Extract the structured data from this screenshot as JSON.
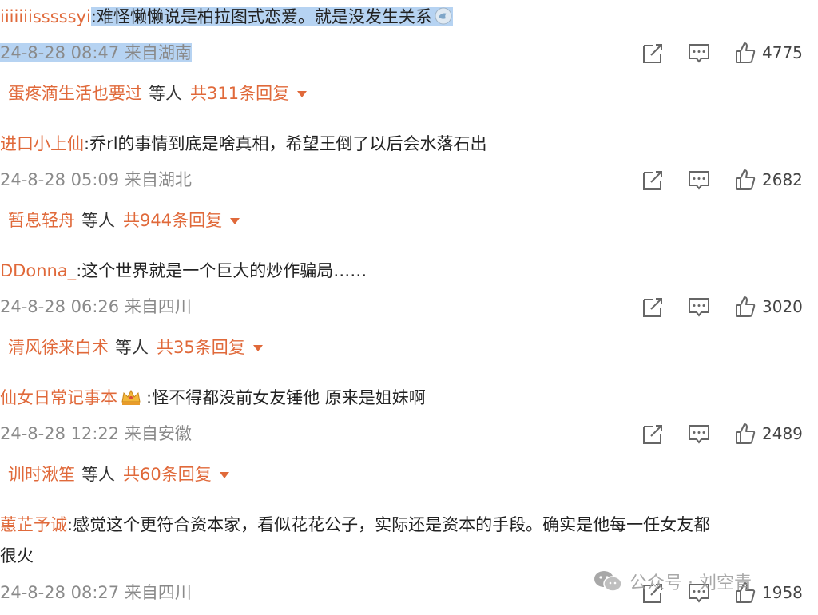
{
  "icons": {
    "share": "share-icon",
    "comment": "comment-icon",
    "like": "thumbs-up-icon",
    "dropdown": "caret-down-icon",
    "wechat": "wechat-logo-icon"
  },
  "colors": {
    "username": "#e0693a",
    "meta": "#8a8a8a",
    "selection": "#b6d3f2"
  },
  "comments": [
    {
      "username": "iiiiiiisssssyi",
      "colon": ":",
      "text": "难怪懒懒说是柏拉图式恋爱。就是没发生关系",
      "meta": "24-8-28 08:47 来自湖南",
      "likes": "4775",
      "reply_user": "蛋疼滴生活也要过",
      "reply_mid": "等人",
      "reply_count": "共311条回复"
    },
    {
      "username": "进口小上仙",
      "colon": ":",
      "text": "乔rl的事情到底是啥真相，希望王倒了以后会水落石出",
      "meta": "24-8-28 05:09 来自湖北",
      "likes": "2682",
      "reply_user": "暂息轻舟",
      "reply_mid": "等人",
      "reply_count": "共944条回复"
    },
    {
      "username": "DDonna_",
      "colon": ":",
      "text": "这个世界就是一个巨大的炒作骗局……",
      "meta": "24-8-28 06:26 来自四川",
      "likes": "3020",
      "reply_user": "清风徐来白术",
      "reply_mid": "等人",
      "reply_count": "共35条回复"
    },
    {
      "username": "仙女日常记事本",
      "colon": ":",
      "text": "怪不得都没前女友锤他 原来是姐妹啊",
      "meta": "24-8-28 12:22 来自安徽",
      "likes": "2489",
      "reply_user": "训时湫笙",
      "reply_mid": "等人",
      "reply_count": "共60条回复"
    },
    {
      "username": "蕙芷予诚",
      "colon": ":",
      "text": "感觉这个更符合资本家，看似花花公子，实际还是资本的手段。确实是他每一任女友都",
      "text2": "很火",
      "meta": "24-8-28 08:27 来自四川",
      "likes": "1958"
    }
  ],
  "watermark": {
    "text": "公众号 · 刘空青"
  }
}
